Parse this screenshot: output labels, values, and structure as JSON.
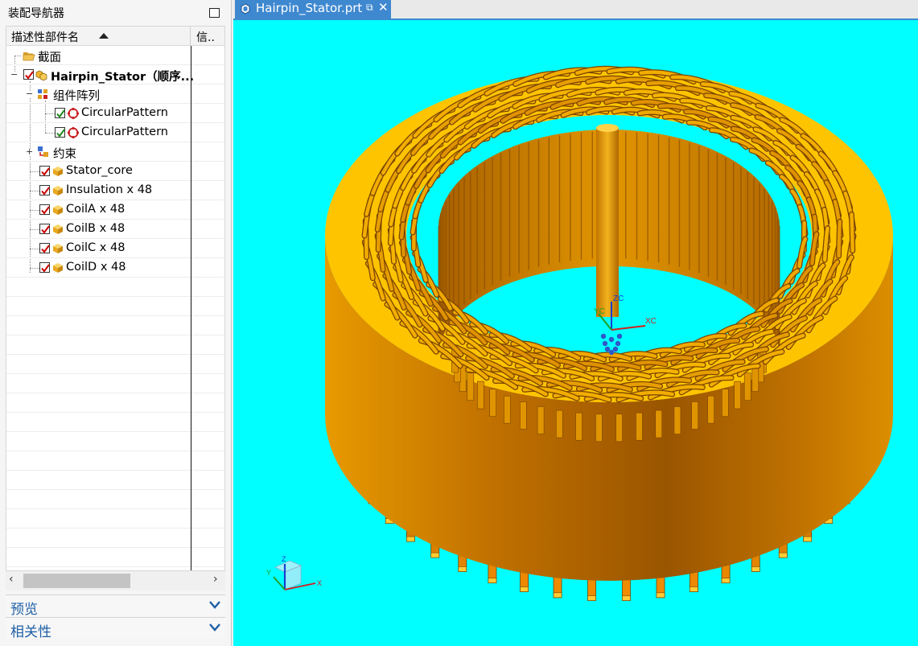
{
  "navigator": {
    "title": "装配导航器",
    "column_name": "描述性部件名",
    "column_info": "信..",
    "rows": [
      {
        "label": "截面"
      },
      {
        "label": "Hairpin_Stator（顺序..."
      },
      {
        "label": "组件阵列"
      },
      {
        "label": "CircularPattern"
      },
      {
        "label": "CircularPattern"
      },
      {
        "label": "约束"
      },
      {
        "label": "Stator_core"
      },
      {
        "label": "Insulation x 48"
      },
      {
        "label": "CoilA x 48"
      },
      {
        "label": "CoilB x 48"
      },
      {
        "label": "CoilC x 48"
      },
      {
        "label": "CoilD x 48"
      }
    ],
    "sections": {
      "preview": "预览",
      "dependencies": "相关性"
    }
  },
  "tab": {
    "title": "Hairpin_Stator.prt"
  },
  "viewport": {
    "background": "#00ffff",
    "part_color": "#f5a800",
    "triad_labels": {
      "xc": "XC",
      "yc": "YC",
      "zc": "ZC"
    },
    "view_triad_labels": {
      "x": "X",
      "y": "Y",
      "z": "Z"
    },
    "hairpin_count": 48
  },
  "colors": {
    "accent": "#3e88d0",
    "section_label": "#1d5fa6",
    "check_red": "#cc0000",
    "check_green": "#1a8a1a"
  }
}
